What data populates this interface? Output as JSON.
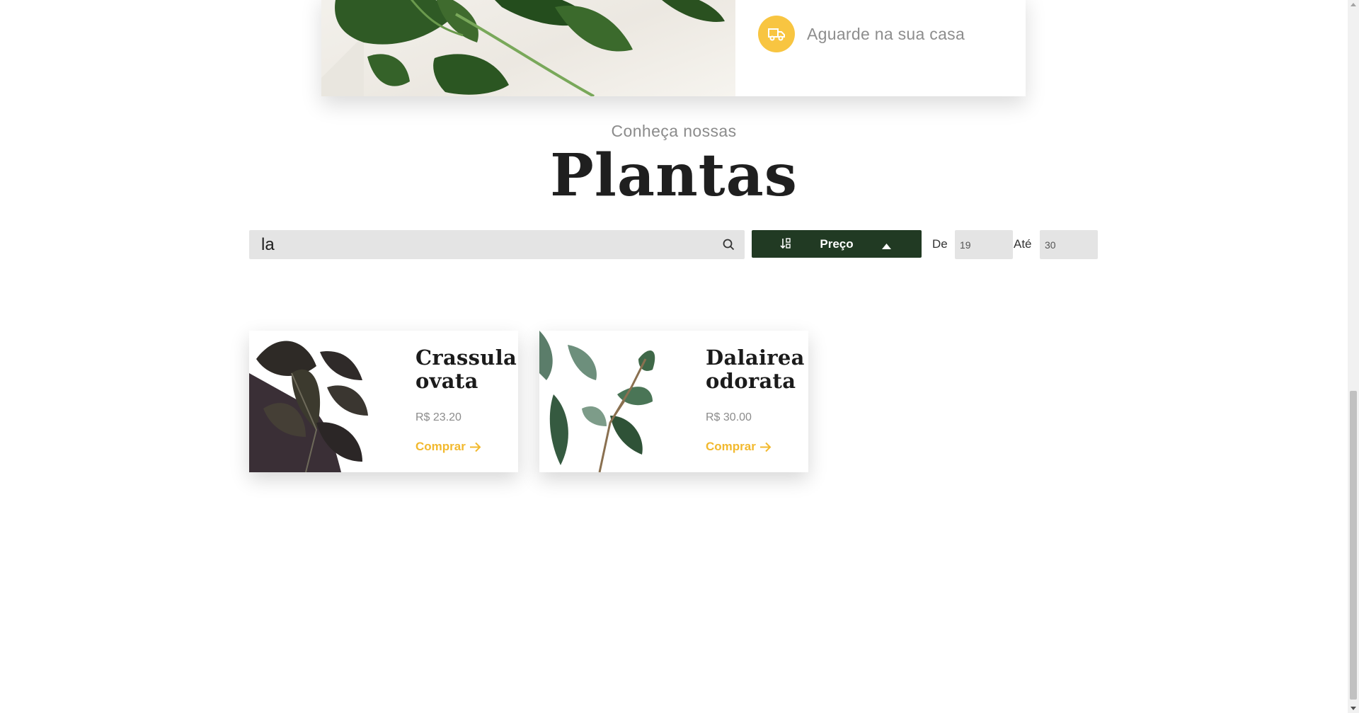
{
  "hero": {
    "step_text": "Aguarde na sua casa",
    "step_icon": "truck-icon",
    "accent_color": "#f8c541"
  },
  "section": {
    "pre_title": "Conheça nossas",
    "title": "Plantas"
  },
  "filters": {
    "search_value": "la",
    "search_icon": "search-icon",
    "sort_label": "Preço",
    "sort_icon": "sort-arrows-icon",
    "sort_direction_icon": "caret-up-icon",
    "from_label": "De",
    "from_value": "19",
    "to_label": "Até",
    "to_value": "30",
    "button_color": "#213a23"
  },
  "products": [
    {
      "name": "Crassula ovata",
      "price": "R$ 23.20",
      "buy_label": "Comprar"
    },
    {
      "name": "Dalairea odorata",
      "price": "R$ 30.00",
      "buy_label": "Comprar"
    }
  ]
}
